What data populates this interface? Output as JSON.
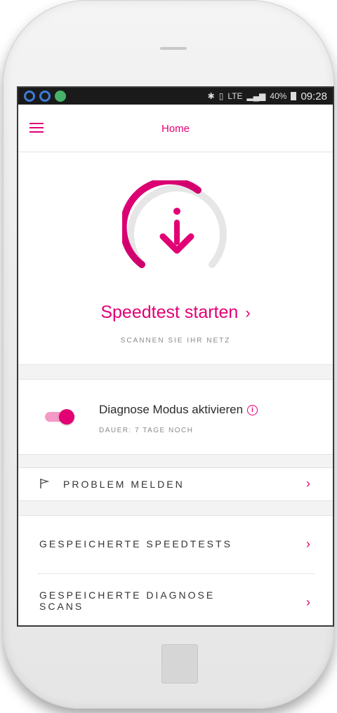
{
  "statusbar": {
    "network": "LTE",
    "battery": "40%",
    "time": "09:28"
  },
  "appbar": {
    "title": "Home"
  },
  "speedtest": {
    "start_label": "Speedtest starten",
    "chevron": "›",
    "subtitle": "SCANNEN SIE IHR NETZ"
  },
  "diagnose": {
    "title": "Diagnose Modus aktivieren",
    "info": "i",
    "duration": "DAUER: 7 TAGE NOCH",
    "enabled": true
  },
  "report": {
    "label": "PROBLEM MELDEN",
    "chevron": "›"
  },
  "saved": {
    "speedtests": "GESPEICHERTE SPEEDTESTS",
    "diagnose_line1": "GESPEICHERTE DIAGNOSE",
    "diagnose_line2": "SCANS",
    "chevron": "›"
  },
  "colors": {
    "accent": "#e20074",
    "accent_light": "#f39ac6",
    "statusbar": "#1a1a1a"
  },
  "icons": [
    "menu-icon",
    "download-icon",
    "info-icon",
    "flag-icon",
    "chevron-right-icon"
  ]
}
